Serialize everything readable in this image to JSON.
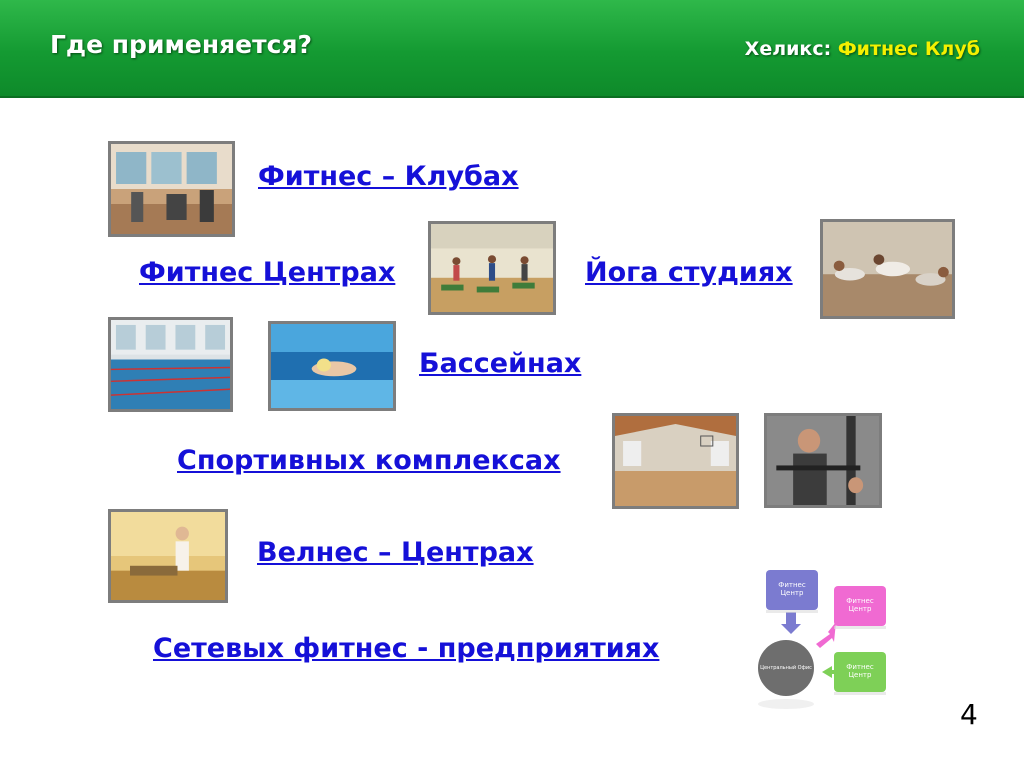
{
  "header": {
    "title": "Где применяется?",
    "brand_prefix": "Хеликс:",
    "brand_name": "Фитнес Клуб"
  },
  "links": {
    "fitness_clubs": "Фитнес – Клубах",
    "fitness_centers": "Фитнес Центрах",
    "yoga_studios": "Йога студиях",
    "pools": "Бассейнах",
    "sport_complexes": "Спортивных комплексах",
    "wellness_centers": "Велнес – Центрах",
    "network_enterprises": "Сетевых фитнес - предприятиях"
  },
  "diagram": {
    "center_label": "Центральный Офис",
    "box1": "Фитнес Центр",
    "box2": "Фитнес Центр",
    "box3": "Фитнес Центр"
  },
  "page_number": "4",
  "colors": {
    "header_green": "#149a32",
    "link_blue": "#1510d8",
    "brand_yellow": "#f4f000"
  }
}
